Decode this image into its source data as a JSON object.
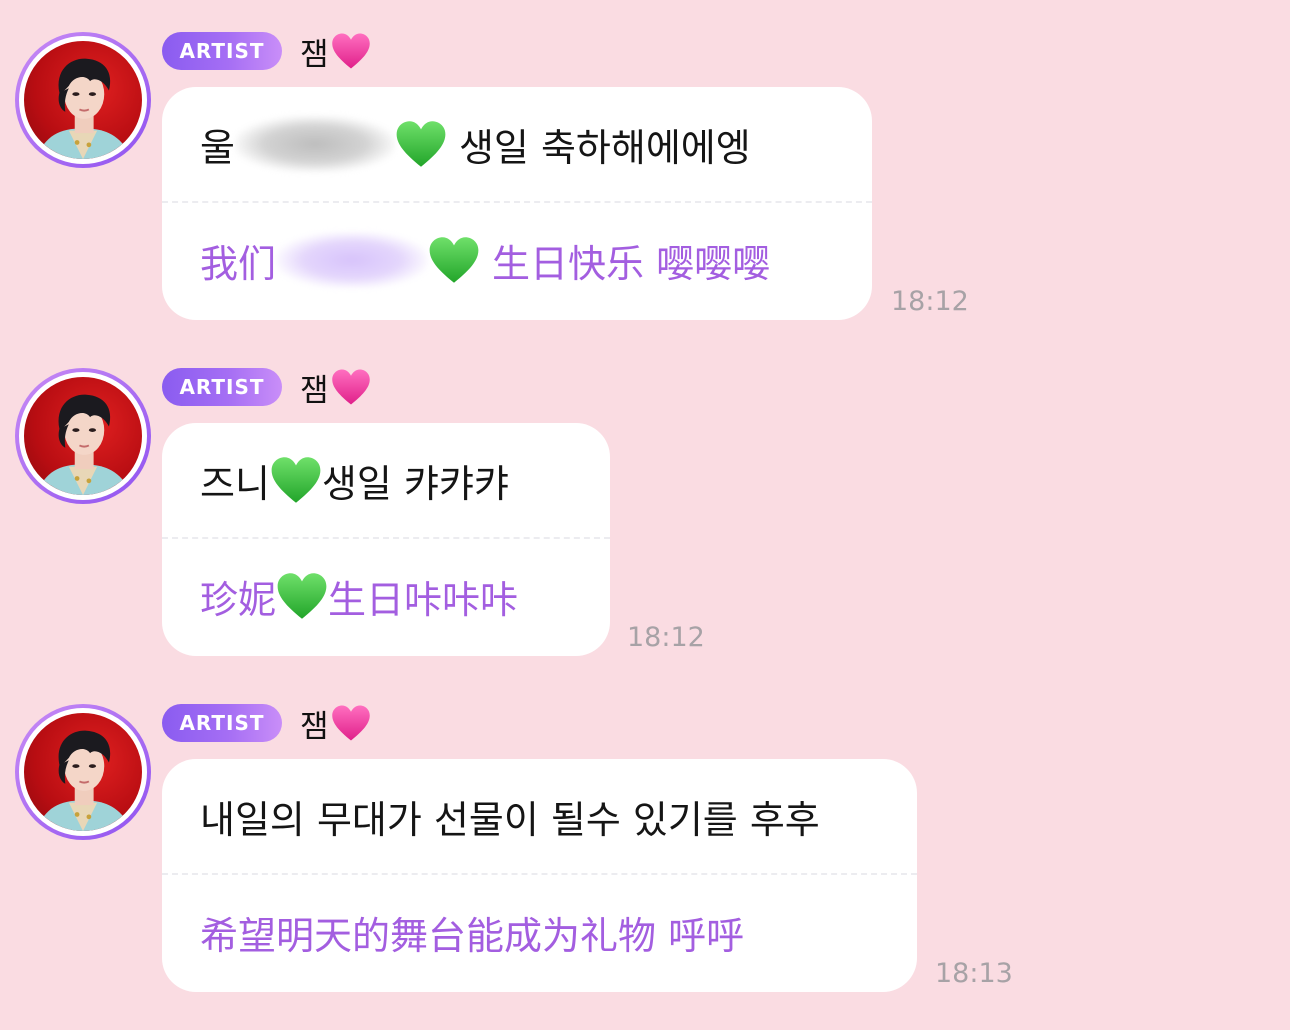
{
  "messages": [
    {
      "badge": "ARTIST",
      "sender": "잼",
      "sender_heart_icon": "pink-heart-icon",
      "korean": {
        "part1": "울",
        "part2": "생일 축하해에에엥"
      },
      "chinese": {
        "part1": "我们",
        "part2": "生日快乐 嘤嘤嘤"
      },
      "time": "18:12"
    },
    {
      "badge": "ARTIST",
      "sender": "잼",
      "sender_heart_icon": "pink-heart-icon",
      "korean": {
        "part1": "즈니",
        "part2": "생일 캬캬캬"
      },
      "chinese": {
        "part1": "珍妮",
        "part2": "生日咔咔咔"
      },
      "time": "18:12"
    },
    {
      "badge": "ARTIST",
      "sender": "잼",
      "sender_heart_icon": "pink-heart-icon",
      "korean": {
        "text": "내일의 무대가 선물이 될수 있기를 후후"
      },
      "chinese": {
        "text": "希望明天的舞台能成为礼物 呼呼"
      },
      "time": "18:13"
    }
  ],
  "colors": {
    "background": "#fadce2",
    "bubble": "#ffffff",
    "translation_text": "#a35ee0",
    "badge_gradient_start": "#8a5cf0",
    "badge_gradient_end": "#c98ef8",
    "heart_pink": "#f0409a",
    "heart_green": "#3cc23c",
    "timestamp": "#a7a2a6"
  }
}
